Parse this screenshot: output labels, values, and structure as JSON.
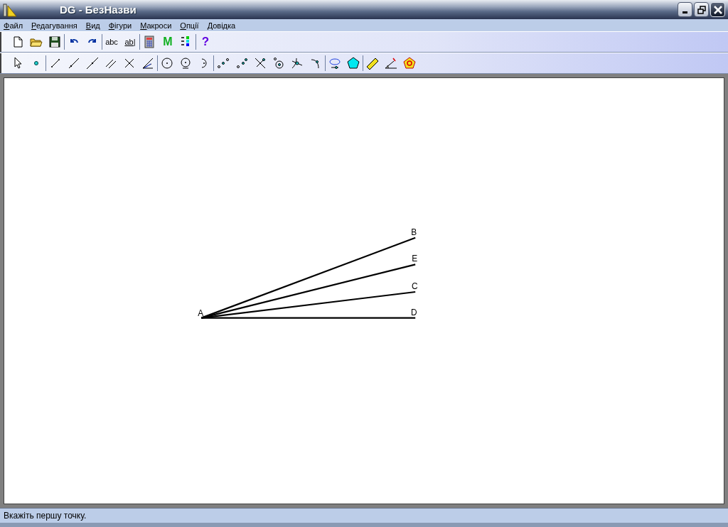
{
  "window": {
    "title": "DG - БезНазви"
  },
  "menu": [
    {
      "label": "Файл"
    },
    {
      "label": "Редагування"
    },
    {
      "label": "Вид"
    },
    {
      "label": "Фігури"
    },
    {
      "label": "Макроси"
    },
    {
      "label": "Опції"
    },
    {
      "label": "Довідка"
    }
  ],
  "toolbar_main": [
    [
      {
        "kind": "page"
      },
      {
        "kind": "folder"
      },
      {
        "kind": "floppy"
      }
    ],
    [
      {
        "kind": "undo"
      },
      {
        "kind": "redo"
      }
    ],
    [
      {
        "kind": "plain-label",
        "label": "abc"
      },
      {
        "kind": "boxed-label",
        "label": "ab|"
      }
    ],
    [
      {
        "kind": "calculator"
      },
      {
        "kind": "green-letter",
        "label": "M"
      },
      {
        "kind": "color-list"
      }
    ],
    [
      {
        "kind": "help-mark",
        "label": "?"
      }
    ]
  ],
  "toolbar_tools": [
    [
      {
        "kind": "cursor"
      },
      {
        "kind": "dot"
      }
    ],
    [
      {
        "kind": "segment"
      },
      {
        "kind": "ray"
      },
      {
        "kind": "line"
      },
      {
        "kind": "parallel"
      },
      {
        "kind": "cross"
      },
      {
        "kind": "angle"
      }
    ],
    [
      {
        "kind": "circle"
      },
      {
        "kind": "circle-dot"
      },
      {
        "kind": "arc"
      }
    ],
    [
      {
        "kind": "midpoint"
      },
      {
        "kind": "point-pair"
      },
      {
        "kind": "intersection"
      },
      {
        "kind": "ring-point"
      },
      {
        "kind": "crossing"
      },
      {
        "kind": "curve-point"
      }
    ],
    [
      {
        "kind": "loop"
      },
      {
        "kind": "pentagon"
      }
    ],
    [
      {
        "kind": "ruler"
      },
      {
        "kind": "angle-gauge"
      },
      {
        "kind": "area-badge"
      }
    ]
  ],
  "canvas": {
    "points": [
      {
        "label": "A"
      },
      {
        "label": "B"
      },
      {
        "label": "E"
      },
      {
        "label": "C"
      },
      {
        "label": "D"
      }
    ]
  },
  "status_bar": {
    "text": "Вкажіть першу точку."
  }
}
